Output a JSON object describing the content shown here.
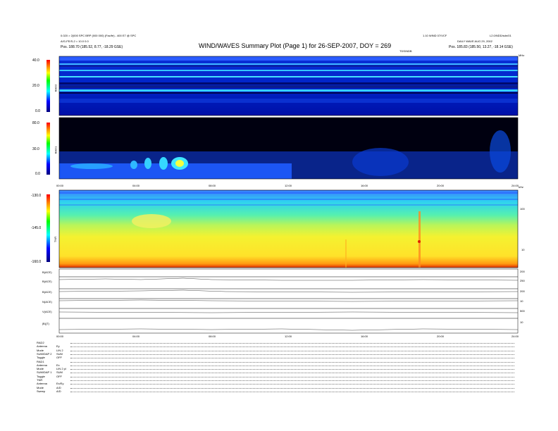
{
  "header": {
    "title": "WIND/WAVES Summary Plot (Page 1) for 26-SEP-2007, DOY = 269",
    "left_line1": "0.020 > 2(000 SPC BRP (000 000) (Fac/fe) - 400 E7 @ SPC",
    "left_line2": "A/G-FE/S-2 = 10.0 0.0",
    "left_line3": "Pos. 188.70 (185.52, 8.77, -18.29 GSE)",
    "right_line1": "1.10 WIND 07/VCF",
    "right_line1b": "L2.0/NDD/sdn/01",
    "right_line2": "DAILY WAVE AUG 29, 2002",
    "right_line3": "Pos. 185.83 (185.50, 13.27, -18.14 GSE)",
    "center_small": "TDS/NDB",
    "top_right_axis": "MHz",
    "bottom_right_axis": "kHz"
  },
  "panels": [
    {
      "name": "RAD2",
      "yticks": [
        "40.0",
        "20.0",
        "0.0"
      ],
      "ylabel": "RAD2"
    },
    {
      "name": "RAD1",
      "yticks": [
        "80.0",
        "30.0",
        "0.0"
      ],
      "ylabel": "RAD1"
    },
    {
      "name": "TNR",
      "yticks": [
        "-130.0",
        "-145.0",
        "-160.0"
      ],
      "ylabel": "TNR"
    }
  ],
  "tnr_right_ticks": [
    "100",
    "10"
  ],
  "time_axis_mid": [
    "00:00",
    "04:00",
    "08:00",
    "12:00",
    "16:00",
    "20:00",
    "24:00"
  ],
  "time_axis_bottom": [
    "00:00",
    "04:00",
    "08:00",
    "12:00",
    "16:00",
    "20:00",
    "24:00"
  ],
  "line_panels": [
    {
      "label": "B(ACE)",
      "right": [
        "200",
        "0"
      ]
    },
    {
      "label": "B(ACE)",
      "right": [
        "250",
        "0"
      ]
    },
    {
      "label": "B(ACE)",
      "right": [
        "200",
        "0"
      ]
    },
    {
      "label": "N(ACE)",
      "right": [
        "10",
        "0"
      ]
    },
    {
      "label": "V(ACE)",
      "right": [
        "500",
        "0"
      ]
    },
    {
      "label": "|B|(T)",
      "right": [
        "10",
        "0"
      ]
    }
  ],
  "footer": [
    {
      "k": "RAD2",
      "v": ""
    },
    {
      "k": "Antenna",
      "v": "Ey"
    },
    {
      "k": "Mode",
      "v": "LIN 2"
    },
    {
      "k": "SUM/DAP 2",
      "v": "SUM"
    },
    {
      "k": "Toggle",
      "v": "OFF"
    },
    {
      "k": "RAD1",
      "v": ""
    },
    {
      "k": "Antenna",
      "v": "Ex"
    },
    {
      "k": "Mode",
      "v": "LIN 2 pl"
    },
    {
      "k": "SUM/DAP 1",
      "v": "SUM"
    },
    {
      "k": "Toggle",
      "v": "OFF"
    },
    {
      "k": "TNR",
      "v": ""
    },
    {
      "k": "Antenna",
      "v": "Ex/Ey"
    },
    {
      "k": "Mode",
      "v": "A/D"
    },
    {
      "k": "Sweep",
      "v": "A/D"
    }
  ],
  "chart_data": {
    "type": "heatmap",
    "title": "WIND/WAVES Summary Plot (Page 1) for 26-SEP-2007, DOY = 269",
    "x": [
      "00:00",
      "04:00",
      "08:00",
      "12:00",
      "16:00",
      "20:00",
      "24:00"
    ],
    "panels": [
      {
        "name": "RAD2",
        "ylim": [
          0,
          40
        ],
        "colorbar": [
          "0.0",
          "20.0",
          "40.0"
        ]
      },
      {
        "name": "RAD1",
        "ylim": [
          0,
          80
        ],
        "colorbar": [
          "0.0",
          "30.0",
          "80.0"
        ]
      },
      {
        "name": "TNR",
        "ylim": [
          -160,
          -130
        ],
        "colorbar": [
          "-160.0",
          "-145.0",
          "-130.0"
        ]
      }
    ],
    "colors": [
      "#000080",
      "#0000ff",
      "#00ffff",
      "#00ff00",
      "#ffff00",
      "#ff8000",
      "#ff0000"
    ]
  }
}
